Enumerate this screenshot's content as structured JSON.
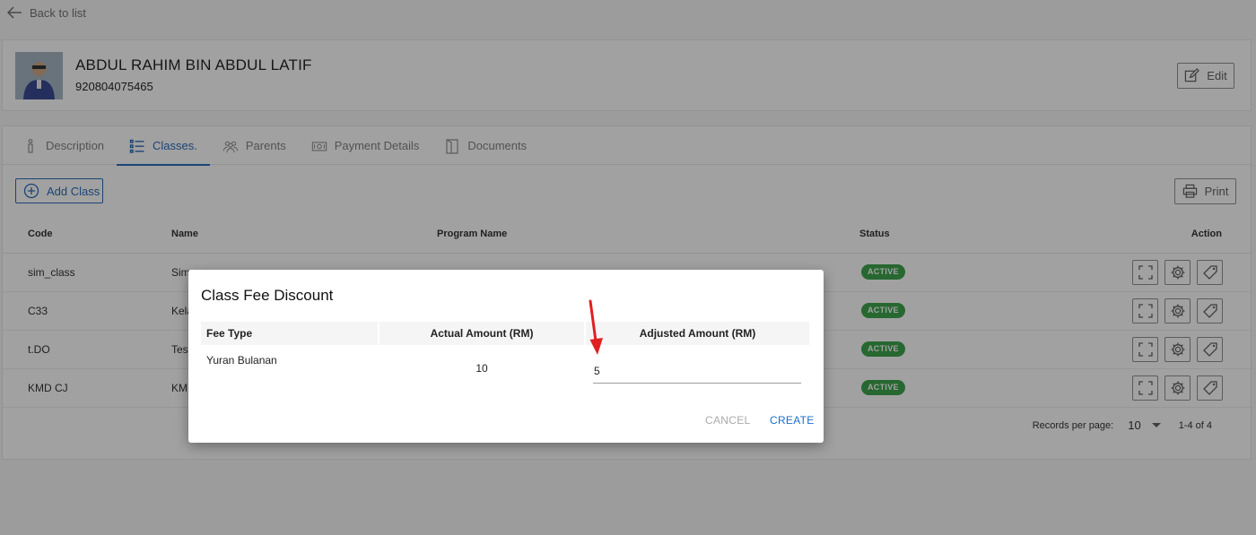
{
  "nav": {
    "back_label": "Back to list"
  },
  "student": {
    "name": "ABDUL RAHIM BIN ABDUL LATIF",
    "id": "920804075465",
    "edit_label": "Edit"
  },
  "tabs": [
    {
      "label": "Description",
      "icon": "info-icon"
    },
    {
      "label": "Classes.",
      "icon": "list-icon",
      "active": true
    },
    {
      "label": "Parents",
      "icon": "people-icon"
    },
    {
      "label": "Payment Details",
      "icon": "money-icon"
    },
    {
      "label": "Documents",
      "icon": "document-icon"
    }
  ],
  "toolbar": {
    "add_class_label": "Add Class",
    "print_label": "Print"
  },
  "table": {
    "headers": {
      "code": "Code",
      "name": "Name",
      "program": "Program Name",
      "status": "Status",
      "action": "Action"
    },
    "rows": [
      {
        "code": "sim_class",
        "name": "Sim",
        "status": "ACTIVE"
      },
      {
        "code": "C33",
        "name": "Kela",
        "status": "ACTIVE"
      },
      {
        "code": "t.DO",
        "name": "Test",
        "status": "ACTIVE"
      },
      {
        "code": "KMD CJ",
        "name": "KMD",
        "status": "ACTIVE"
      }
    ]
  },
  "pagination": {
    "records_label": "Records per page:",
    "per_page": "10",
    "range": "1-4 of 4"
  },
  "dialog": {
    "title": "Class Fee Discount",
    "headers": {
      "fee_type": "Fee Type",
      "actual": "Actual Amount (RM)",
      "adjusted": "Adjusted Amount (RM)"
    },
    "row": {
      "fee_type": "Yuran Bulanan",
      "actual": "10",
      "adjusted": "5"
    },
    "cancel_label": "CANCEL",
    "create_label": "CREATE"
  },
  "colors": {
    "accent": "#1a5fb4",
    "status_active": "#2e9d3f",
    "arrow": "#e02020"
  }
}
